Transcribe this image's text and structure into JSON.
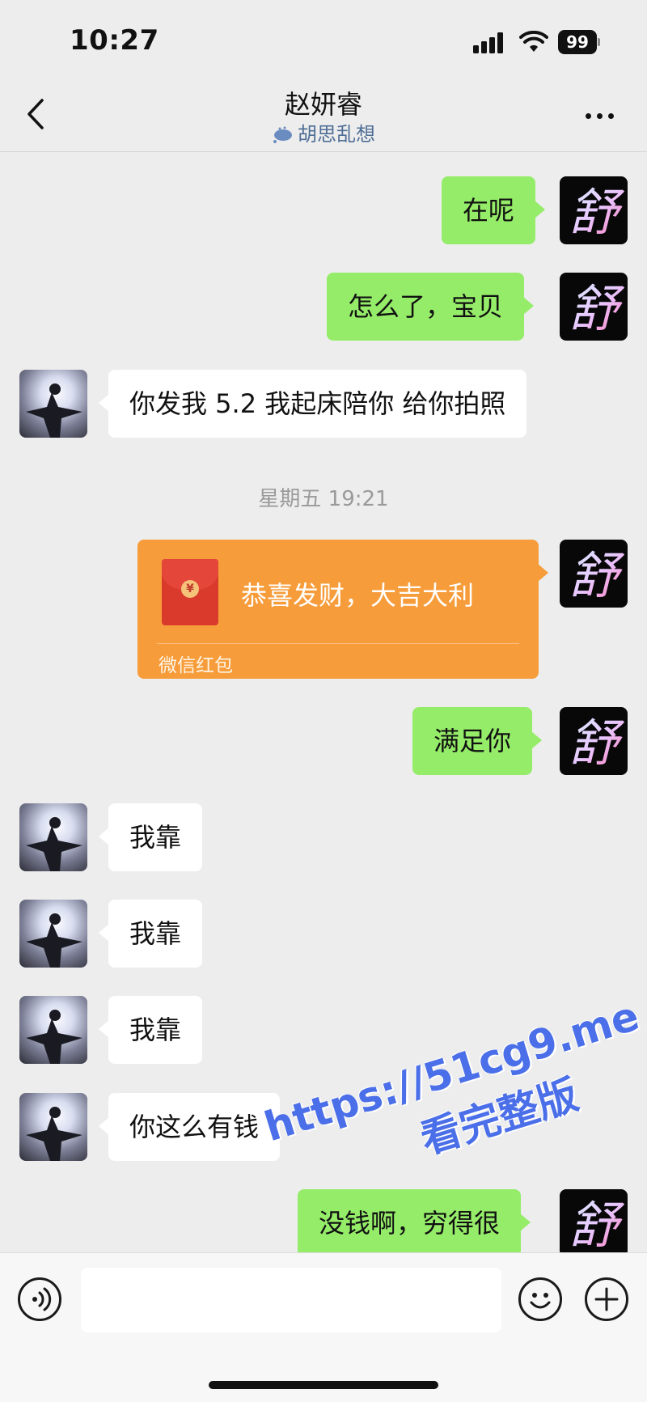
{
  "status_bar": {
    "time": "10:27",
    "battery": "99"
  },
  "header": {
    "title": "赵妍睿",
    "status": "胡思乱想",
    "back_icon": "chevron-left-icon",
    "more_icon": "more-dots-icon"
  },
  "messages": [
    {
      "side": "right",
      "text": "在呢"
    },
    {
      "side": "right",
      "text": "怎么了，宝贝"
    },
    {
      "side": "left",
      "text": "你发我 5.2 我起床陪你 给你拍照"
    },
    {
      "side": "right",
      "text": "满足你"
    },
    {
      "side": "left",
      "text": "我靠"
    },
    {
      "side": "left",
      "text": "我靠"
    },
    {
      "side": "left",
      "text": "我靠"
    },
    {
      "side": "left",
      "text": "你这么有钱"
    },
    {
      "side": "right",
      "text": "没钱啊，穷得很"
    }
  ],
  "timestamp": "星期五 19:21",
  "red_packet": {
    "title": "恭喜发财，大吉大利",
    "label": "微信红包",
    "coin_symbol": "¥"
  },
  "avatar_right_glyph": "舒",
  "watermark": {
    "url": "https://51cg9.me",
    "text": "看完整版"
  },
  "colors": {
    "background": "#ededed",
    "bubble_self": "#95ec69",
    "bubble_other": "#ffffff",
    "red_packet": "#f79c3a",
    "watermark": "#4b6fe8"
  },
  "input_bar": {
    "voice_icon": "voice-icon",
    "emoji_icon": "emoji-icon",
    "plus_icon": "plus-icon"
  }
}
